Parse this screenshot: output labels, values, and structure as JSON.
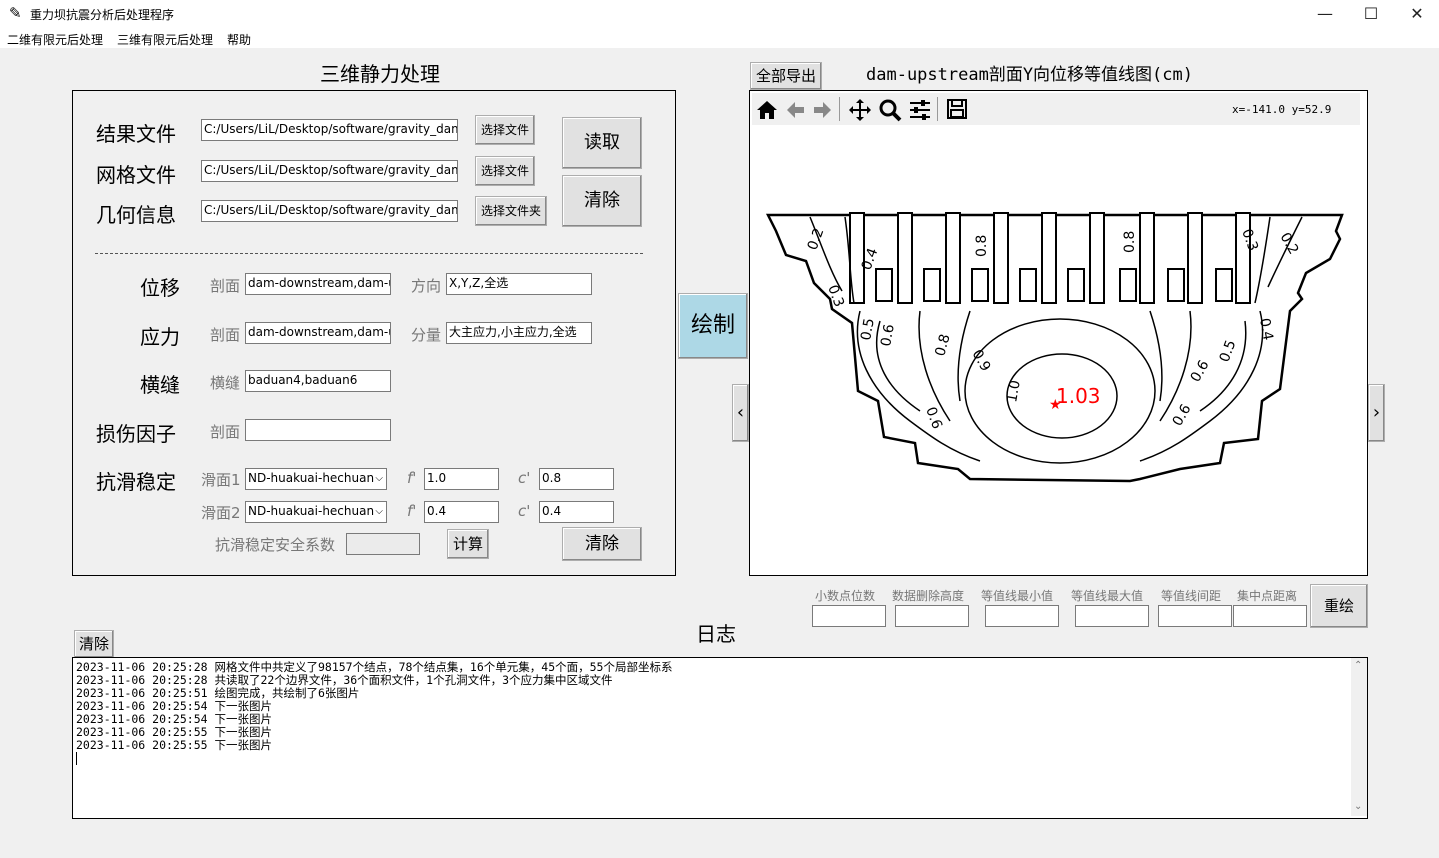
{
  "window": {
    "title": "重力坝抗震分析后处理程序",
    "controls": {
      "minimize": "—",
      "maximize": "☐",
      "close": "✕"
    }
  },
  "menu": [
    "二维有限元后处理",
    "三维有限元后处理",
    "帮助"
  ],
  "left_panel": {
    "title": "三维静力处理",
    "files": [
      {
        "label": "结果文件",
        "value": "C:/Users/LiL/Desktop/software/gravity_dam",
        "button": "选择文件"
      },
      {
        "label": "网格文件",
        "value": "C:/Users/LiL/Desktop/software/gravity_dam",
        "button": "选择文件"
      },
      {
        "label": "几何信息",
        "value": "C:/Users/LiL/Desktop/software/gravity_dam",
        "button": "选择文件夹"
      }
    ],
    "read_button": "读取",
    "clear_button": "清除",
    "displacement": {
      "label": "位移",
      "section_label": "剖面",
      "section_value": "dam-downstream,dam-u",
      "dir_label": "方向",
      "dir_value": "X,Y,Z,全选"
    },
    "stress": {
      "label": "应力",
      "section_label": "剖面",
      "section_value": "dam-downstream,dam-u",
      "comp_label": "分量",
      "comp_value": "大主应力,小主应力,全选"
    },
    "joint": {
      "label": "横缝",
      "sub_label": "横缝",
      "value": "baduan4,baduan6"
    },
    "damage": {
      "label": "损伤因子",
      "section_label": "剖面",
      "value": ""
    },
    "sliding": {
      "label": "抗滑稳定",
      "surface1": {
        "label": "滑面1",
        "value": "ND-huakuai-hechuan",
        "f_label": "f'",
        "f_value": "1.0",
        "c_label": "c'",
        "c_value": "0.8"
      },
      "surface2": {
        "label": "滑面2",
        "value": "ND-huakuai-hechuan",
        "f_label": "f'",
        "f_value": "0.4",
        "c_label": "c'",
        "c_value": "0.4"
      },
      "safety_label": "抗滑稳定安全系数",
      "safety_value": "",
      "calc_button": "计算",
      "clear_button": "清除"
    }
  },
  "draw_button": "绘制",
  "export_button": "全部导出",
  "plot": {
    "title": "dam-upstream剖面Y向位移等值线图(cm)",
    "coords": "x=-141.0 y=52.9",
    "toolbar_icons": [
      "home-icon",
      "back-icon",
      "forward-icon",
      "pan-icon",
      "zoom-icon",
      "configure-icon",
      "save-icon"
    ],
    "contour_labels": [
      "0.2",
      "0.4",
      "0.3",
      "0.8",
      "0.8",
      "0.3",
      "0.2",
      "0.4",
      "0.5",
      "0.6",
      "0.8",
      "0.9",
      "1.0",
      "0.5",
      "0.6",
      "0.6",
      "0.6"
    ],
    "max_label": "1.03",
    "nav_prev": "‹",
    "nav_next": "›"
  },
  "redraw_panel": {
    "labels": [
      "小数点位数",
      "数据删除高度",
      "等值线最小值",
      "等值线最大值",
      "等值线间距",
      "集中点距离"
    ],
    "values": [
      "",
      "",
      "",
      "",
      "",
      ""
    ],
    "button": "重绘"
  },
  "log": {
    "title": "日志",
    "clear_button": "清除",
    "lines": [
      "2023-11-06 20:25:28 网格文件中共定义了98157个结点，78个结点集，16个单元集，45个面，55个局部坐标系",
      "2023-11-06 20:25:28 共读取了22个边界文件，36个面积文件，1个孔洞文件，3个应力集中区域文件",
      "2023-11-06 20:25:51 绘图完成，共绘制了6张图片",
      "2023-11-06 20:25:54 下一张图片",
      "2023-11-06 20:25:54 下一张图片",
      "2023-11-06 20:25:55 下一张图片",
      "2023-11-06 20:25:55 下一张图片"
    ]
  },
  "colors": {
    "draw_button_bg": "#add8e6",
    "max_marker": "#ff0000"
  }
}
